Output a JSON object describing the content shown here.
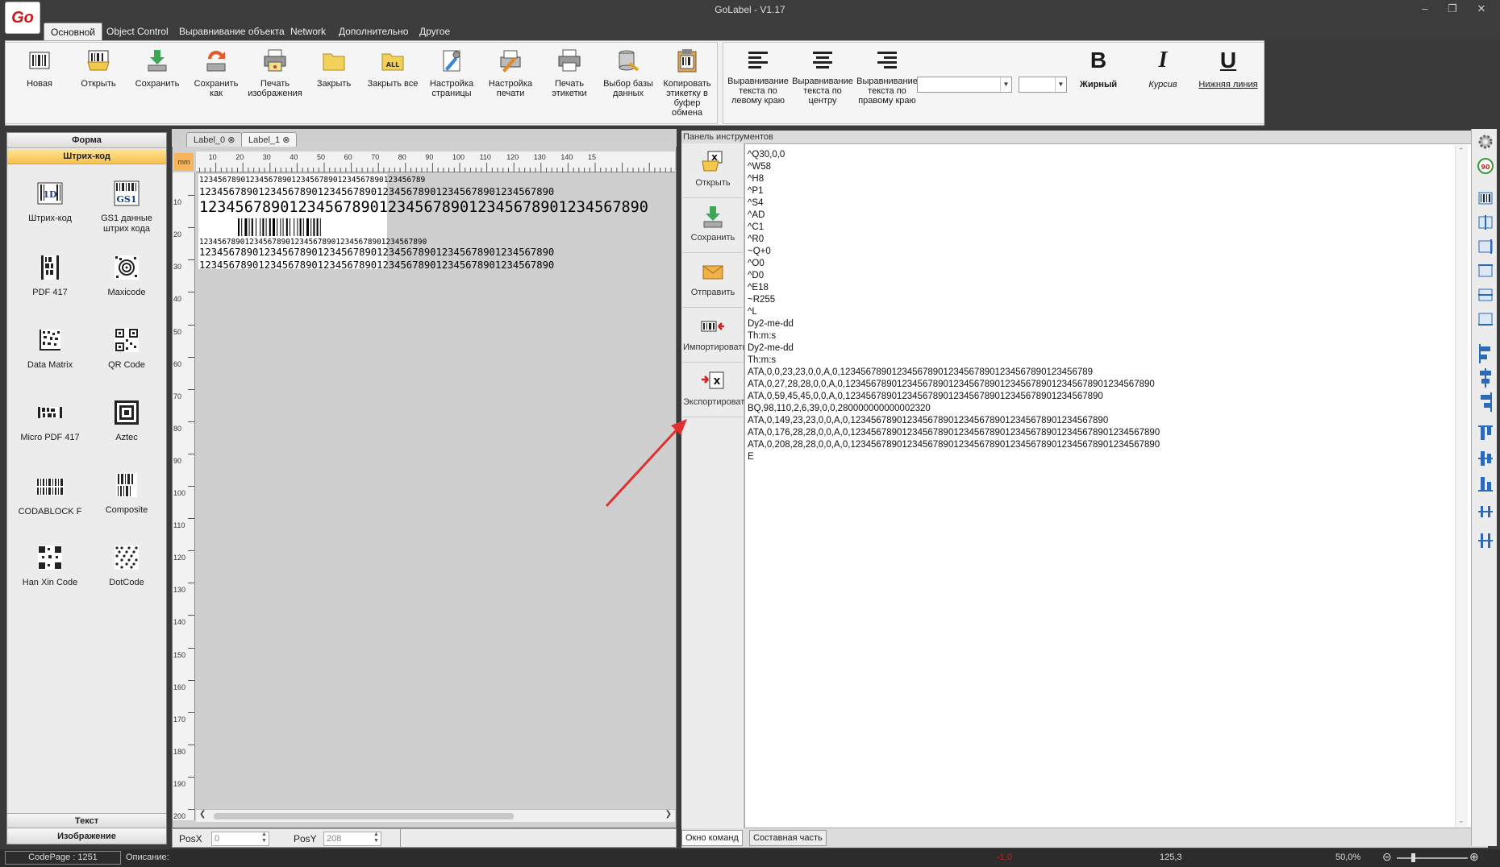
{
  "window": {
    "title": "GoLabel - V1.17",
    "logo_text": "Go"
  },
  "ribbon_tabs": [
    "Основной",
    "Object Control",
    "Выравнивание объекта",
    "Network",
    "Дополнительно",
    "Другое"
  ],
  "ribbon": {
    "buttons": [
      {
        "label": "Новая",
        "icon": "new-label-icon"
      },
      {
        "label": "Открыть",
        "icon": "open-icon"
      },
      {
        "label": "Сохранить",
        "icon": "save-icon"
      },
      {
        "label": "Сохранить как",
        "icon": "save-as-icon"
      },
      {
        "label": "Печать изображения",
        "icon": "print-image-icon"
      },
      {
        "label": "Закрыть",
        "icon": "close-folder-icon"
      },
      {
        "label": "Закрыть все",
        "icon": "close-all-icon"
      },
      {
        "label": "Настройка страницы",
        "icon": "page-setup-icon"
      },
      {
        "label": "Настройка печати",
        "icon": "print-setup-icon"
      },
      {
        "label": "Печать этикетки",
        "icon": "print-label-icon"
      },
      {
        "label": "Выбор базы данных",
        "icon": "database-icon"
      },
      {
        "label": "Копировать этикетку в буфер обмена",
        "icon": "copy-clipboard-icon"
      }
    ],
    "align": [
      {
        "label": "Выравнивание текста по левому краю",
        "icon": "align-left-icon"
      },
      {
        "label": "Выравнивание текста по центру",
        "icon": "align-center-icon"
      },
      {
        "label": "Выравнивание текста по правому краю",
        "icon": "align-right-icon"
      }
    ],
    "font": {
      "bold_label": "Жирный",
      "italic_label": "Курсив",
      "underline_label": "Нижняя линия",
      "bold_glyph": "B",
      "italic_glyph": "I",
      "underline_glyph": "U"
    }
  },
  "left_panel": {
    "sections": {
      "forma": "Форма",
      "barcode": "Штрих-код",
      "text": "Текст",
      "image": "Изображение"
    },
    "barcodes": [
      {
        "label": "Штрих-код",
        "icon": "1d-barcode-icon",
        "glyph": "1D"
      },
      {
        "label": "GS1 данные штрих кода",
        "icon": "gs1-barcode-icon",
        "glyph": "GS1"
      },
      {
        "label": "PDF 417",
        "icon": "pdf417-icon"
      },
      {
        "label": "Maxicode",
        "icon": "maxicode-icon"
      },
      {
        "label": "Data Matrix",
        "icon": "datamatrix-icon"
      },
      {
        "label": "QR Code",
        "icon": "qrcode-icon"
      },
      {
        "label": "Micro PDF 417",
        "icon": "micro-pdf417-icon"
      },
      {
        "label": "Aztec",
        "icon": "aztec-icon"
      },
      {
        "label": "CODABLOCK F",
        "icon": "codablock-icon"
      },
      {
        "label": "Composite",
        "icon": "composite-icon"
      },
      {
        "label": "Han Xin Code",
        "icon": "hanxin-icon"
      },
      {
        "label": "DotCode",
        "icon": "dotcode-icon"
      }
    ]
  },
  "editor": {
    "tabs": [
      "Label_0",
      "Label_1"
    ],
    "unit": "mm",
    "hruler": [
      "10",
      "20",
      "30",
      "40",
      "50",
      "60",
      "70",
      "80",
      "90",
      "100",
      "110",
      "120",
      "130",
      "140",
      "15"
    ],
    "vruler": [
      "10",
      "20",
      "30",
      "40",
      "50",
      "60",
      "70",
      "80",
      "90",
      "100",
      "110",
      "120",
      "130",
      "140",
      "150",
      "160",
      "170",
      "180",
      "190",
      "200"
    ],
    "label_lines": [
      "1234567890123456789012345678901234567890123456789",
      "123456789012345678901234567890123456789012345678901234567890",
      "12345678901234567890123456789012345678901234567890",
      "12345678901234567890123456789012345678901234567890",
      "123456789012345678901234567890123456789012345678901234567890",
      "123456789012345678901234567890123456789012345678901234567890"
    ],
    "posx_label": "PosX",
    "posx_value": "0",
    "posy_label": "PosY",
    "posy_value": "208"
  },
  "tools": {
    "header": "Панель инструментов",
    "buttons": [
      {
        "label": "Открыть",
        "icon": "open-cmd-icon"
      },
      {
        "label": "Сохранить",
        "icon": "save-cmd-icon"
      },
      {
        "label": "Отправить",
        "icon": "send-icon"
      },
      {
        "label": "Импортировать",
        "icon": "import-icon"
      },
      {
        "label": "Экспортировать",
        "icon": "export-icon"
      }
    ],
    "commands": "^Q30,0,0\n^W58\n^H8\n^P1\n^S4\n^AD\n^C1\n^R0\n~Q+0\n^O0\n^D0\n^E18\n~R255\n^L\nDy2-me-dd\nTh:m:s\nDy2-me-dd\nTh:m:s\nATA,0,0,23,23,0,0,A,0,1234567890123456789012345678901234567890123456789\nATA,0,27,28,28,0,0,A,0,123456789012345678901234567890123456789012345678901234567890\nATA,0,59,45,45,0,0,A,0,12345678901234567890123456789012345678901234567890\nBQ,98,110,2,6,39,0,0,280000000000002320\nATA,0,149,23,23,0,0,A,0,12345678901234567890123456789012345678901234567890\nATA,0,176,28,28,0,0,A,0,123456789012345678901234567890123456789012345678901234567890\nATA,0,208,28,28,0,0,A,0,123456789012345678901234567890123456789012345678901234567890\nE",
    "bottom_tabs": [
      "Окно команд",
      "Составная часть"
    ]
  },
  "status": {
    "codepage": "CodePage : 1251",
    "description_label": "Описание:",
    "value_red": "-1,0",
    "coord": "125,3",
    "zoom": "50,0%"
  },
  "colors": {
    "accent_orange": "#f7c24a",
    "arrow_red": "#e03030",
    "dark_chrome": "#3c3c3c"
  }
}
